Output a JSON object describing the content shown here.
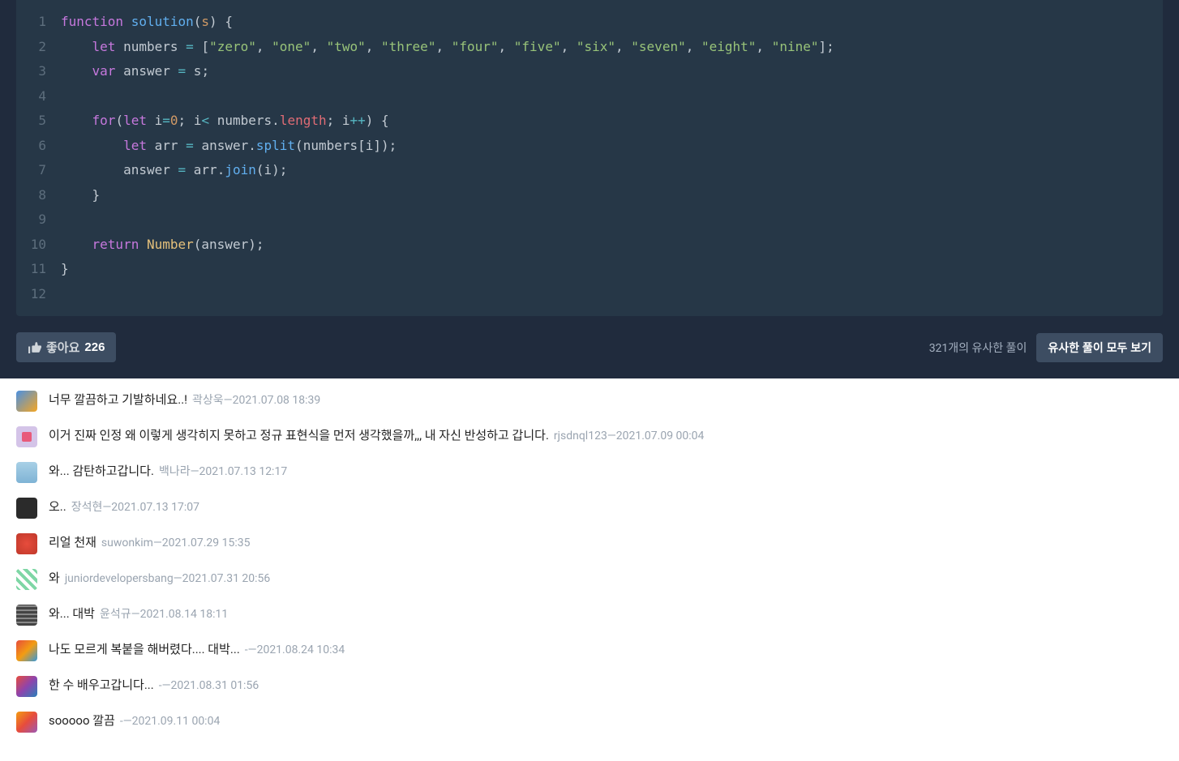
{
  "code": {
    "lines": [
      {
        "n": "1",
        "html": "<span class='kw-function'>function</span> <span class='fn-name'>solution</span><span class='punct'>(</span><span class='param'>s</span><span class='punct'>) {</span>"
      },
      {
        "n": "2",
        "html": "    <span class='kw-let'>let</span> <span class='ident'>numbers</span> <span class='operator'>=</span> <span class='punct'>[</span><span class='string'>\"zero\"</span><span class='punct'>, </span><span class='string'>\"one\"</span><span class='punct'>, </span><span class='string'>\"two\"</span><span class='punct'>, </span><span class='string'>\"three\"</span><span class='punct'>, </span><span class='string'>\"four\"</span><span class='punct'>, </span><span class='string'>\"five\"</span><span class='punct'>, </span><span class='string'>\"six\"</span><span class='punct'>, </span><span class='string'>\"seven\"</span><span class='punct'>, </span><span class='string'>\"eight\"</span><span class='punct'>, </span><span class='string'>\"nine\"</span><span class='punct'>];</span>"
      },
      {
        "n": "3",
        "html": "    <span class='kw-var'>var</span> <span class='ident'>answer</span> <span class='operator'>=</span> <span class='ident'>s</span><span class='punct'>;</span>"
      },
      {
        "n": "4",
        "html": ""
      },
      {
        "n": "5",
        "html": "    <span class='kw-for'>for</span><span class='punct'>(</span><span class='kw-let'>let</span> <span class='ident'>i</span><span class='operator'>=</span><span class='number'>0</span><span class='punct'>; </span><span class='ident'>i</span><span class='operator'>&lt;</span> <span class='ident'>numbers</span><span class='punct'>.</span><span class='prop'>length</span><span class='punct'>; </span><span class='ident'>i</span><span class='operator'>++</span><span class='punct'>) {</span>"
      },
      {
        "n": "6",
        "html": "        <span class='kw-let'>let</span> <span class='ident'>arr</span> <span class='operator'>=</span> <span class='ident'>answer</span><span class='punct'>.</span><span class='fn-name'>split</span><span class='punct'>(</span><span class='ident'>numbers</span><span class='punct'>[</span><span class='ident'>i</span><span class='punct'>]);</span>"
      },
      {
        "n": "7",
        "html": "        <span class='ident'>answer</span> <span class='operator'>=</span> <span class='ident'>arr</span><span class='punct'>.</span><span class='fn-name'>join</span><span class='punct'>(</span><span class='ident'>i</span><span class='punct'>);</span>"
      },
      {
        "n": "8",
        "html": "    <span class='punct'>}</span>"
      },
      {
        "n": "9",
        "html": ""
      },
      {
        "n": "10",
        "html": "    <span class='kw-return'>return</span> <span class='fn-call'>Number</span><span class='punct'>(</span><span class='ident'>answer</span><span class='punct'>);</span>"
      },
      {
        "n": "11",
        "html": "<span class='punct'>}</span>"
      },
      {
        "n": "12",
        "html": ""
      }
    ]
  },
  "actions": {
    "like_label": "좋아요",
    "like_count": "226",
    "similar_count": "321개의 유사한 풀이",
    "similar_button": "유사한 풀이 모두 보기"
  },
  "comments": [
    {
      "text": "너무 깔끔하고 기발하네요..!",
      "meta": "곽상욱―2021.07.08 18:39",
      "av": "av1"
    },
    {
      "text": "이거 진짜 인정 왜 이렇게 생각히지 못하고 정규 표현식을 먼저 생각했을까,,, 내 자신 반성하고 갑니다.",
      "meta": "rjsdnql123―2021.07.09 00:04",
      "av": "av2"
    },
    {
      "text": "와... 감탄하고갑니다.",
      "meta": "백나라―2021.07.13 12:17",
      "av": "av3"
    },
    {
      "text": "오..",
      "meta": "장석현―2021.07.13 17:07",
      "av": "av4"
    },
    {
      "text": "리얼 천재",
      "meta": "suwonkim―2021.07.29 15:35",
      "av": "av5"
    },
    {
      "text": "와",
      "meta": "juniordevelopersbang―2021.07.31 20:56",
      "av": "av6"
    },
    {
      "text": "와... 대박",
      "meta": "윤석규―2021.08.14 18:11",
      "av": "av7"
    },
    {
      "text": "나도 모르게 복붙을 해버렸다.... 대박...",
      "meta": "-―2021.08.24 10:34",
      "av": "av8"
    },
    {
      "text": "한 수 배우고갑니다...",
      "meta": "-―2021.08.31 01:56",
      "av": "av9"
    },
    {
      "text": "sooooo 깔끔",
      "meta": "-―2021.09.11 00:04",
      "av": "av10"
    }
  ]
}
